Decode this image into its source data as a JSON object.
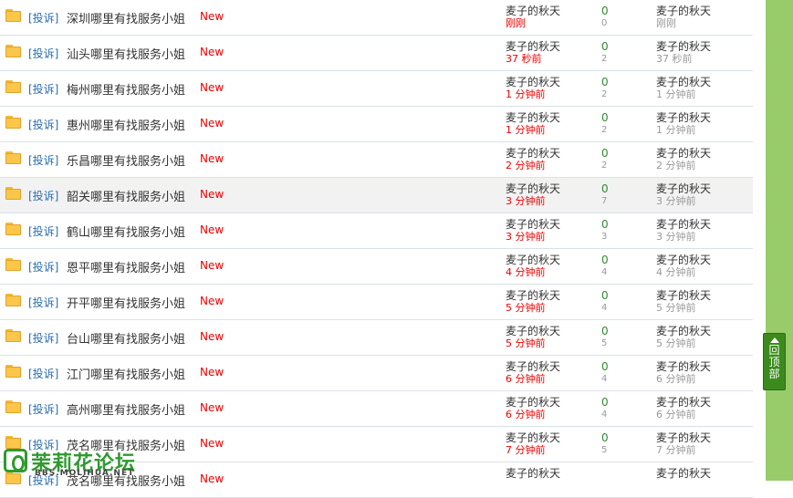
{
  "threads": [
    {
      "report": "[投诉]",
      "title": "深圳哪里有找服务小姐",
      "badge": "New",
      "author": "麦子的秋天",
      "post_time": "刚刚",
      "replies": "0",
      "views": "0",
      "last_author": "麦子的秋天",
      "last_time": "刚刚"
    },
    {
      "report": "[投诉]",
      "title": "汕头哪里有找服务小姐",
      "badge": "New",
      "author": "麦子的秋天",
      "post_time": "37 秒前",
      "replies": "0",
      "views": "2",
      "last_author": "麦子的秋天",
      "last_time": "37 秒前"
    },
    {
      "report": "[投诉]",
      "title": "梅州哪里有找服务小姐",
      "badge": "New",
      "author": "麦子的秋天",
      "post_time": "1 分钟前",
      "replies": "0",
      "views": "2",
      "last_author": "麦子的秋天",
      "last_time": "1 分钟前"
    },
    {
      "report": "[投诉]",
      "title": "惠州哪里有找服务小姐",
      "badge": "New",
      "author": "麦子的秋天",
      "post_time": "1 分钟前",
      "replies": "0",
      "views": "2",
      "last_author": "麦子的秋天",
      "last_time": "1 分钟前"
    },
    {
      "report": "[投诉]",
      "title": "乐昌哪里有找服务小姐",
      "badge": "New",
      "author": "麦子的秋天",
      "post_time": "2 分钟前",
      "replies": "0",
      "views": "2",
      "last_author": "麦子的秋天",
      "last_time": "2 分钟前"
    },
    {
      "report": "[投诉]",
      "title": "韶关哪里有找服务小姐",
      "badge": "New",
      "author": "麦子的秋天",
      "post_time": "3 分钟前",
      "replies": "0",
      "views": "7",
      "last_author": "麦子的秋天",
      "last_time": "3 分钟前"
    },
    {
      "report": "[投诉]",
      "title": "鹤山哪里有找服务小姐",
      "badge": "New",
      "author": "麦子的秋天",
      "post_time": "3 分钟前",
      "replies": "0",
      "views": "3",
      "last_author": "麦子的秋天",
      "last_time": "3 分钟前"
    },
    {
      "report": "[投诉]",
      "title": "恩平哪里有找服务小姐",
      "badge": "New",
      "author": "麦子的秋天",
      "post_time": "4 分钟前",
      "replies": "0",
      "views": "4",
      "last_author": "麦子的秋天",
      "last_time": "4 分钟前"
    },
    {
      "report": "[投诉]",
      "title": "开平哪里有找服务小姐",
      "badge": "New",
      "author": "麦子的秋天",
      "post_time": "5 分钟前",
      "replies": "0",
      "views": "4",
      "last_author": "麦子的秋天",
      "last_time": "5 分钟前"
    },
    {
      "report": "[投诉]",
      "title": "台山哪里有找服务小姐",
      "badge": "New",
      "author": "麦子的秋天",
      "post_time": "5 分钟前",
      "replies": "0",
      "views": "5",
      "last_author": "麦子的秋天",
      "last_time": "5 分钟前"
    },
    {
      "report": "[投诉]",
      "title": "江门哪里有找服务小姐",
      "badge": "New",
      "author": "麦子的秋天",
      "post_time": "6 分钟前",
      "replies": "0",
      "views": "4",
      "last_author": "麦子的秋天",
      "last_time": "6 分钟前"
    },
    {
      "report": "[投诉]",
      "title": "高州哪里有找服务小姐",
      "badge": "New",
      "author": "麦子的秋天",
      "post_time": "6 分钟前",
      "replies": "0",
      "views": "4",
      "last_author": "麦子的秋天",
      "last_time": "6 分钟前"
    },
    {
      "report": "[投诉]",
      "title": "茂名哪里有找服务小姐",
      "badge": "New",
      "author": "麦子的秋天",
      "post_time": "7 分钟前",
      "replies": "0",
      "views": "5",
      "last_author": "麦子的秋天",
      "last_time": "7 分钟前"
    },
    {
      "report": "[投诉]",
      "title": "茂名哪里有找服务小姐",
      "badge": "New",
      "author": "麦子的秋天",
      "post_time": "",
      "replies": "",
      "views": "",
      "last_author": "麦子的秋天",
      "last_time": ""
    }
  ],
  "highlight_index": 5,
  "back_to_top": {
    "label": "回顶部"
  },
  "watermark": {
    "name": "茉莉花论坛",
    "domain": "BBS.MOLIHUA.NET"
  },
  "colors": {
    "sidebar": "#98cc6b",
    "button": "#3c8a1c",
    "link": "#2a6db0",
    "new": "#ee0000",
    "replies": "#2e8b2e"
  }
}
